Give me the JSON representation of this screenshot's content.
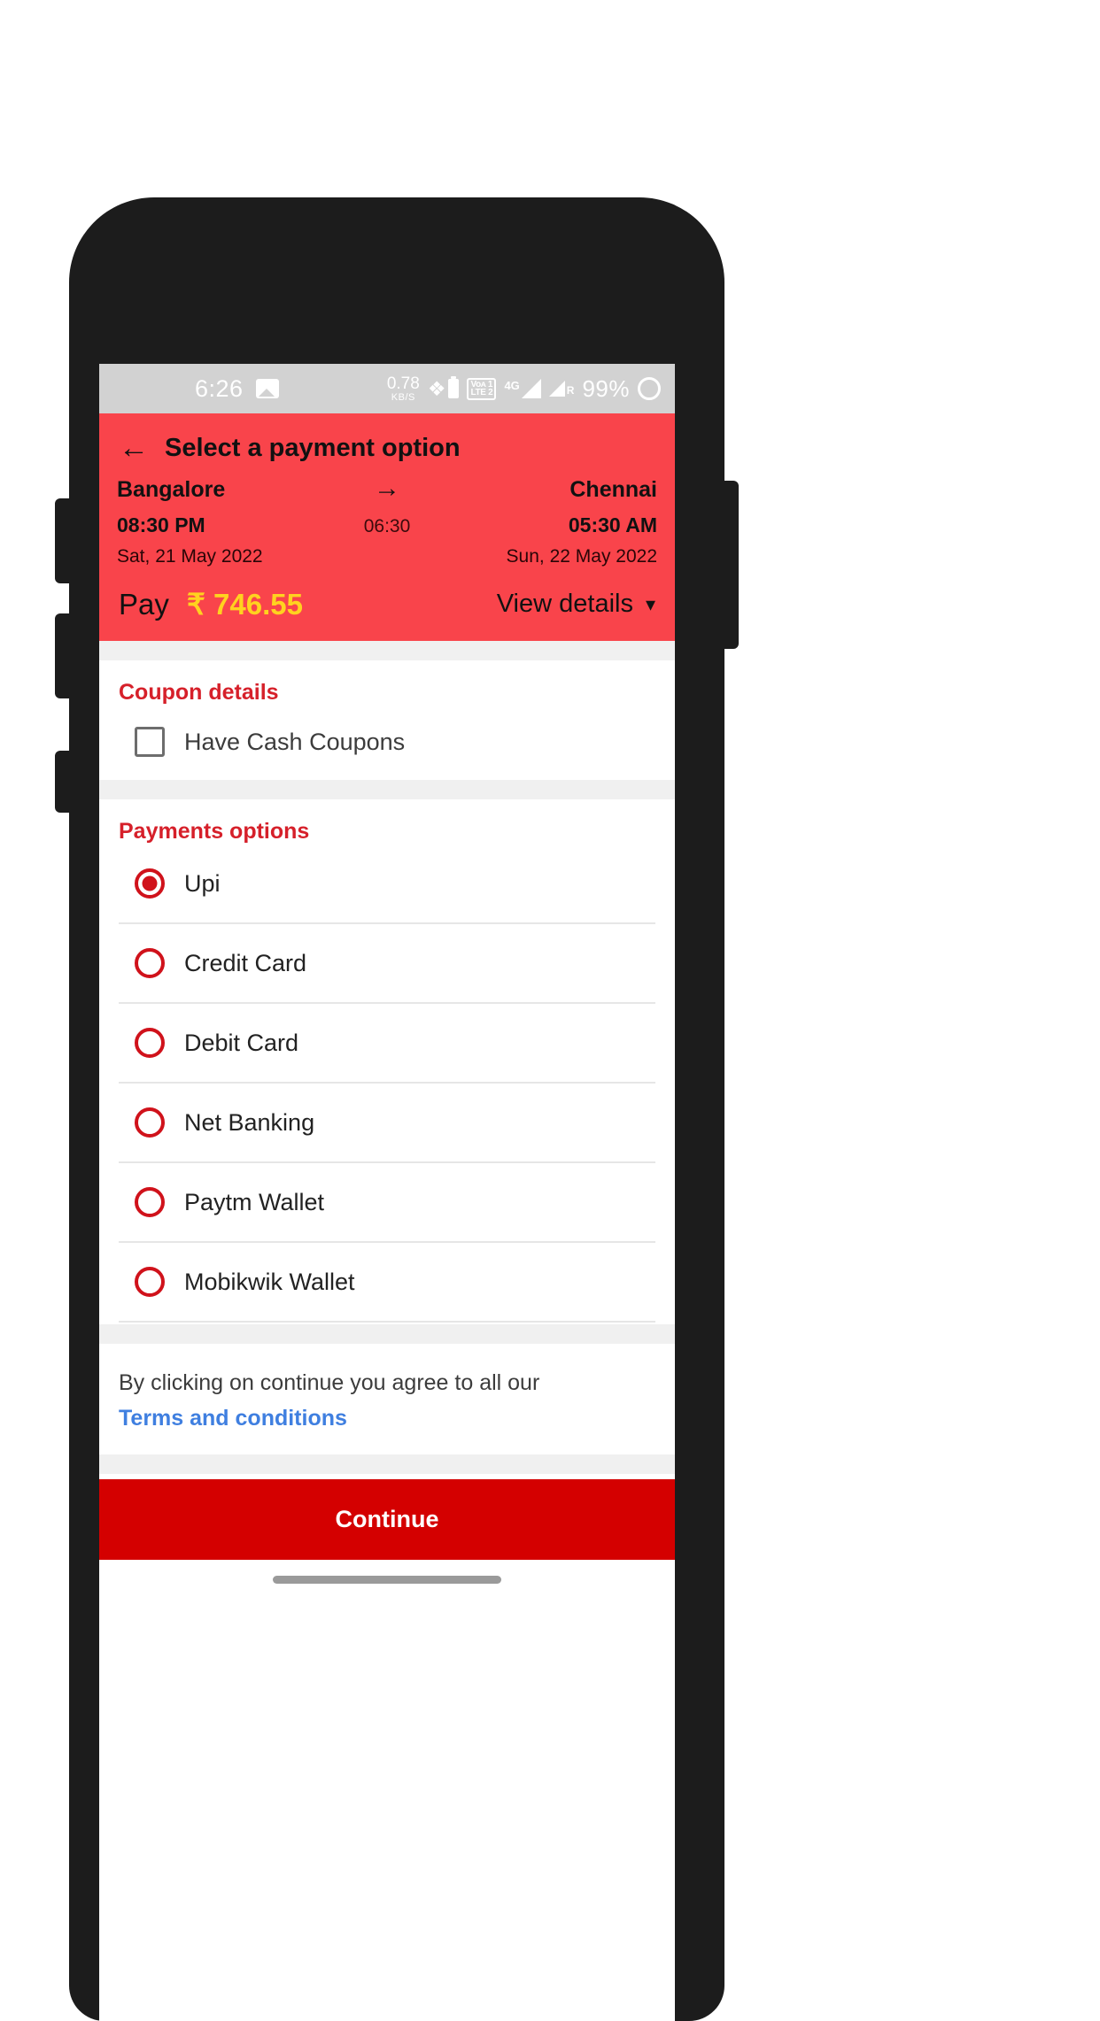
{
  "status_bar": {
    "clock": "6:26",
    "photo_icon": "image-icon",
    "data_rate": "0.78",
    "data_rate_unit": "KB/S",
    "bluetooth_icon": "bluetooth-icon",
    "battery_icon": "battery-icon",
    "volte_line1": "Voᴀ 1",
    "volte_line2": "LTE 2",
    "network_type": "4G",
    "roaming_label": "R",
    "battery_percent": "99%",
    "circle_icon": "circle-icon"
  },
  "header": {
    "back_icon": "back-arrow-icon",
    "title": "Select a payment option",
    "journey": {
      "from_city": "Bangalore",
      "to_city": "Chennai",
      "arrow_icon": "arrow-right-icon",
      "depart_time": "08:30 PM",
      "arrive_time": "05:30 AM",
      "duration": "06:30",
      "depart_date": "Sat, 21 May 2022",
      "arrive_date": "Sun, 22 May 2022"
    },
    "pay_label": "Pay",
    "pay_amount": "₹ 746.55",
    "view_details_label": "View details",
    "chevron_icon": "chevron-down-icon"
  },
  "coupon": {
    "section_title": "Coupon details",
    "checkbox_label": "Have Cash Coupons",
    "checked": false
  },
  "payments": {
    "section_title": "Payments options",
    "options": [
      {
        "label": "Upi",
        "selected": true
      },
      {
        "label": "Credit Card",
        "selected": false
      },
      {
        "label": "Debit Card",
        "selected": false
      },
      {
        "label": "Net Banking",
        "selected": false
      },
      {
        "label": "Paytm Wallet",
        "selected": false
      },
      {
        "label": "Mobikwik Wallet",
        "selected": false
      }
    ]
  },
  "terms": {
    "text": "By clicking on continue you agree to all our",
    "link": "Terms and conditions"
  },
  "footer": {
    "continue_label": "Continue"
  },
  "colors": {
    "header_red": "#f9444b",
    "accent_red": "#d0121b",
    "section_heading_red": "#d6202a",
    "amount_yellow": "#ffd21f",
    "link_blue": "#3f7fe0",
    "continue_red": "#d40000",
    "status_bar_gray": "#d2d2d2",
    "divider_gray": "#e6e6e6"
  }
}
